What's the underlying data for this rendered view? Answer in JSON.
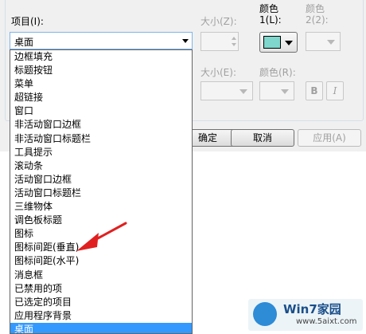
{
  "dialog": {
    "item_label": "项目(I):",
    "item_selected": "桌面",
    "size1_label": "大小(Z):",
    "color1_label_line1": "颜色",
    "color1_label_line2": "1(L):",
    "color2_label_line1": "颜色",
    "color2_label_line2": "2(2):",
    "size2_label": "大小(E):",
    "color_font_label": "颜色(R):",
    "bold_label": "B",
    "italic_label": "I",
    "color1_value": "#7fd6cc"
  },
  "buttons": {
    "ok": "确定",
    "cancel": "取消",
    "apply": "应用(A)"
  },
  "list": {
    "items": [
      "边框填充",
      "标题按钮",
      "菜单",
      "超链接",
      "窗口",
      "非活动窗口边框",
      "非活动窗口标题栏",
      "工具提示",
      "滚动条",
      "活动窗口边框",
      "活动窗口标题栏",
      "三维物体",
      "调色板标题",
      "图标",
      "图标间距(垂直)",
      "图标间距(水平)",
      "消息框",
      "已禁用的项",
      "已选定的项目",
      "应用程序背景",
      "桌面"
    ],
    "selected_index": 20
  },
  "annotation": {
    "arrow_color": "#e02020"
  },
  "watermark": {
    "title": "Win7家园",
    "url": "www.5aixt.com"
  }
}
